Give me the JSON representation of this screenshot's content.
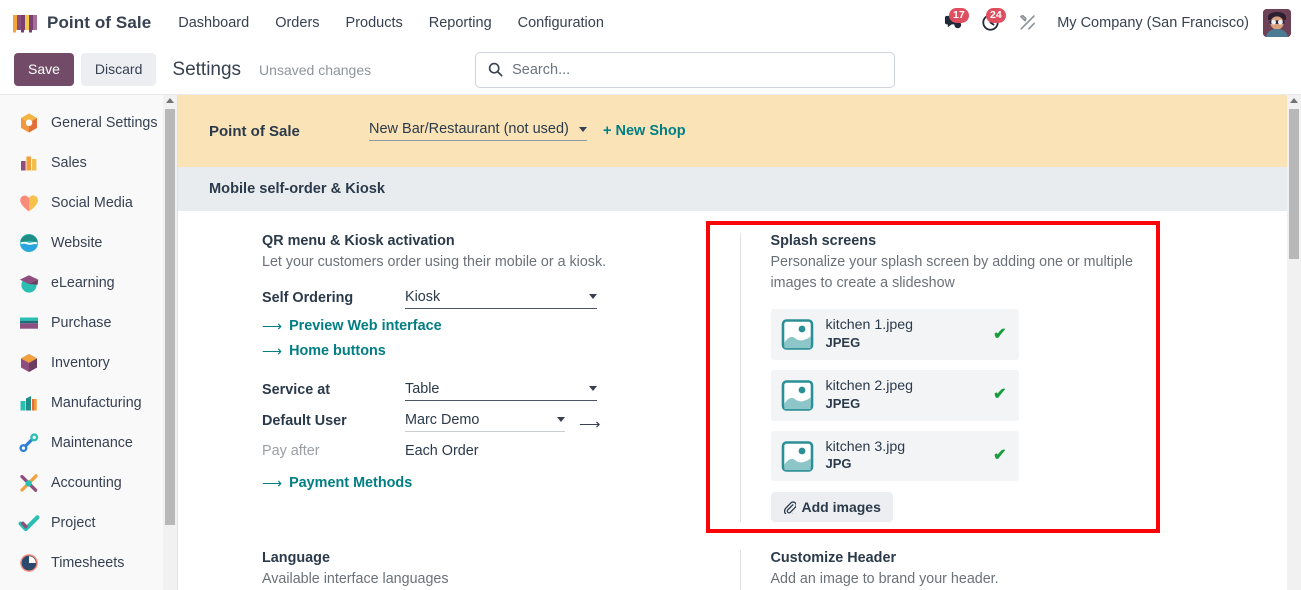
{
  "navbar": {
    "brand": "Point of Sale",
    "brand_icon": "pos-awning-icon",
    "links": [
      "Dashboard",
      "Orders",
      "Products",
      "Reporting",
      "Configuration"
    ],
    "messages_icon": "chat-bubble-icon",
    "messages_count": "17",
    "activities_icon": "clock-icon",
    "activities_count": "24",
    "tools_icon": "wrench-screwdriver-icon",
    "company": "My Company (San Francisco)",
    "avatar_icon": "user-avatar"
  },
  "control_panel": {
    "save_label": "Save",
    "discard_label": "Discard",
    "title": "Settings",
    "status": "Unsaved changes",
    "search_icon": "search-icon",
    "search_placeholder": "Search...",
    "search_value": ""
  },
  "sidebar": {
    "items": [
      {
        "label": "General Settings",
        "icon": "general-settings-icon"
      },
      {
        "label": "Sales",
        "icon": "sales-icon"
      },
      {
        "label": "Social Media",
        "icon": "social-media-icon"
      },
      {
        "label": "Website",
        "icon": "website-icon"
      },
      {
        "label": "eLearning",
        "icon": "elearning-icon"
      },
      {
        "label": "Purchase",
        "icon": "purchase-icon"
      },
      {
        "label": "Inventory",
        "icon": "inventory-icon"
      },
      {
        "label": "Manufacturing",
        "icon": "manufacturing-icon"
      },
      {
        "label": "Maintenance",
        "icon": "maintenance-icon"
      },
      {
        "label": "Accounting",
        "icon": "accounting-icon"
      },
      {
        "label": "Project",
        "icon": "project-icon"
      },
      {
        "label": "Timesheets",
        "icon": "timesheets-icon"
      }
    ]
  },
  "pos_band": {
    "title": "Point of Sale",
    "shop_value": "New Bar/Restaurant (not used)",
    "new_shop_label": "+ New Shop"
  },
  "section": {
    "title": "Mobile self-order & Kiosk"
  },
  "qr_kiosk": {
    "title": "QR menu & Kiosk activation",
    "description": "Let your customers order using their mobile or a kiosk.",
    "self_ordering_label": "Self Ordering",
    "self_ordering_value": "Kiosk",
    "preview_link": "Preview Web interface",
    "home_buttons_link": "Home buttons",
    "service_at_label": "Service at",
    "service_at_value": "Table",
    "default_user_label": "Default User",
    "default_user_value": "Marc Demo",
    "pay_after_label": "Pay after",
    "pay_after_value": "Each Order",
    "payment_methods_link": "Payment Methods"
  },
  "splash": {
    "title": "Splash screens",
    "description": "Personalize your splash screen by adding one or multiple images to create a slideshow",
    "files": [
      {
        "name": "kitchen 1.jpeg",
        "type": "JPEG",
        "icon": "image-file-icon",
        "status_icon": "check-icon"
      },
      {
        "name": "kitchen 2.jpeg",
        "type": "JPEG",
        "icon": "image-file-icon",
        "status_icon": "check-icon"
      },
      {
        "name": "kitchen 3.jpg",
        "type": "JPG",
        "icon": "image-file-icon",
        "status_icon": "check-icon"
      }
    ],
    "add_label": "Add images",
    "add_icon": "paperclip-icon",
    "highlight_color": "#fa0505"
  },
  "language": {
    "title": "Language",
    "description": "Available interface languages"
  },
  "customize_header": {
    "title": "Customize Header",
    "description": "Add an image to brand your header."
  }
}
